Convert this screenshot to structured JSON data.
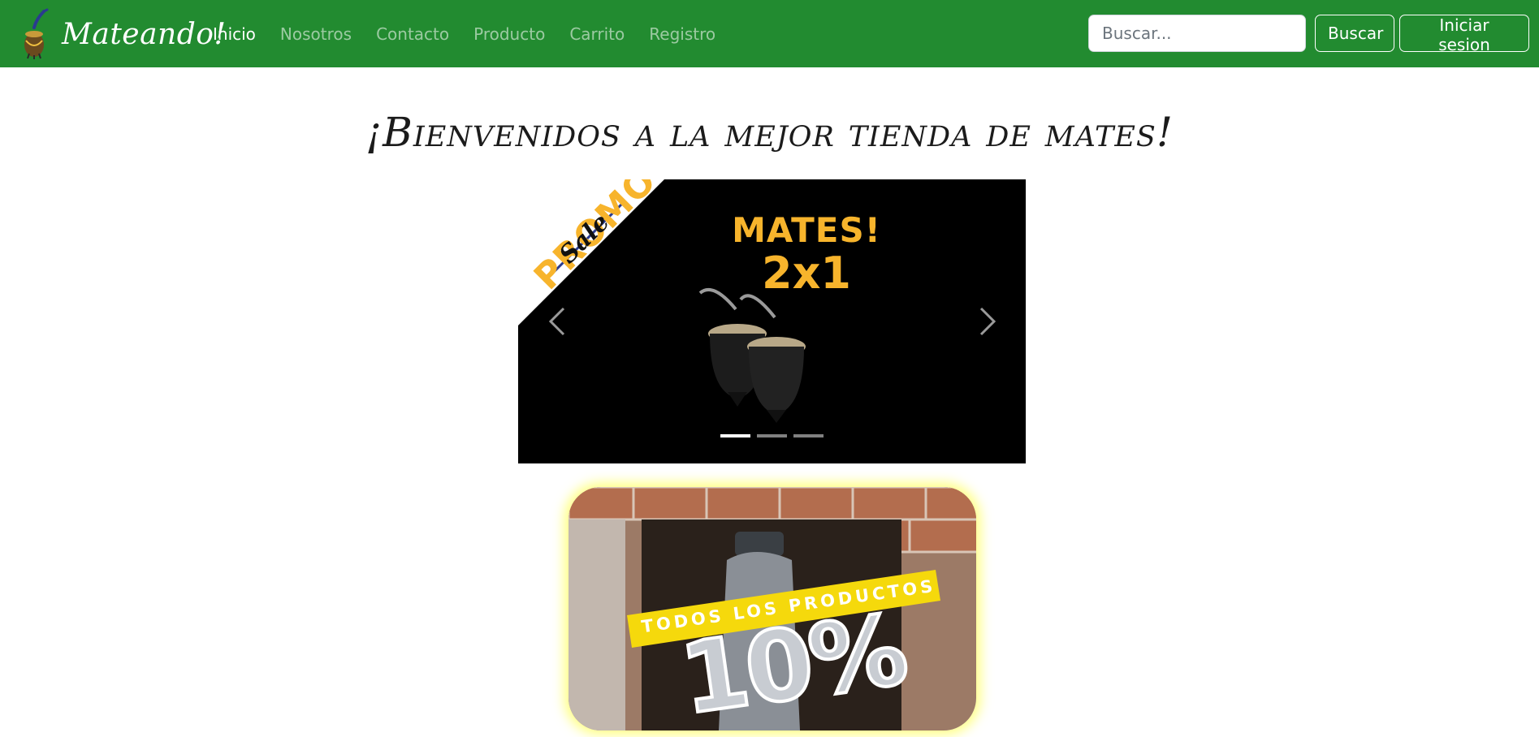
{
  "navbar": {
    "brand": "Mateando!",
    "links": [
      {
        "label": "Inicio",
        "active": true
      },
      {
        "label": "Nosotros",
        "active": false
      },
      {
        "label": "Contacto",
        "active": false
      },
      {
        "label": "Producto",
        "active": false
      },
      {
        "label": "Carrito",
        "active": false
      },
      {
        "label": "Registro",
        "active": false
      }
    ],
    "search_placeholder": "Buscar...",
    "search_button": "Buscar",
    "login_button": "Iniciar sesion"
  },
  "main": {
    "title": "¡Bienvenidos a la mejor tienda de mates!",
    "carousel": {
      "slide": {
        "corner_label": "PROMO",
        "corner_script": "Sale",
        "heading": "MATES!",
        "subheading": "2x1"
      },
      "active_index": 0,
      "slide_count": 3
    },
    "promo_card": {
      "banner": "TODOS LOS PRODUCTOS",
      "discount": "10%"
    }
  },
  "colors": {
    "navbar": "#228b30",
    "promo_yellow": "#f7b42c",
    "banner_yellow": "#f5d90c"
  },
  "icons": [
    "mate-logo-icon",
    "chevron-left-icon",
    "chevron-right-icon"
  ]
}
